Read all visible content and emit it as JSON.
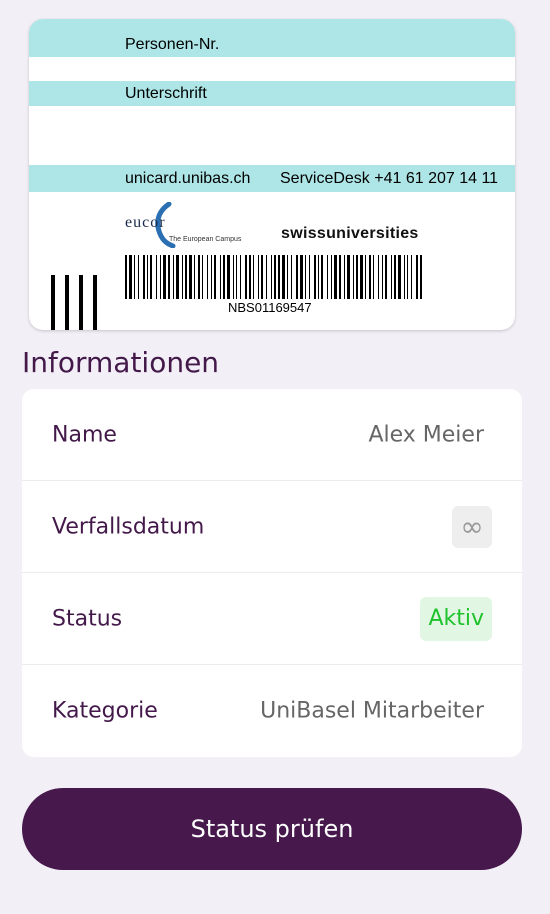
{
  "card": {
    "field_person_nr": "Personen-Nr.",
    "field_signature": "Unterschrift",
    "website": "unicard.unibas.ch",
    "servicedesk": "ServiceDesk +41 61 207 14 11",
    "eucor_logo_text": "eucor",
    "eucor_subtitle": "The European Campus",
    "swissuniversities_text": "swissuniversities",
    "barcode_number": "NBS01169547"
  },
  "info": {
    "title": "Informationen",
    "rows": [
      {
        "label": "Name",
        "value": "Alex Meier"
      },
      {
        "label": "Verfallsdatum",
        "value": "∞"
      },
      {
        "label": "Status",
        "value": "Aktiv"
      },
      {
        "label": "Kategorie",
        "value": "UniBasel Mitarbeiter"
      }
    ]
  },
  "actions": {
    "check_status": "Status prüfen"
  },
  "colors": {
    "accent": "#46184c",
    "band": "#aee5e6",
    "status_active": "#1ec22b",
    "background": "#f2eff6"
  }
}
